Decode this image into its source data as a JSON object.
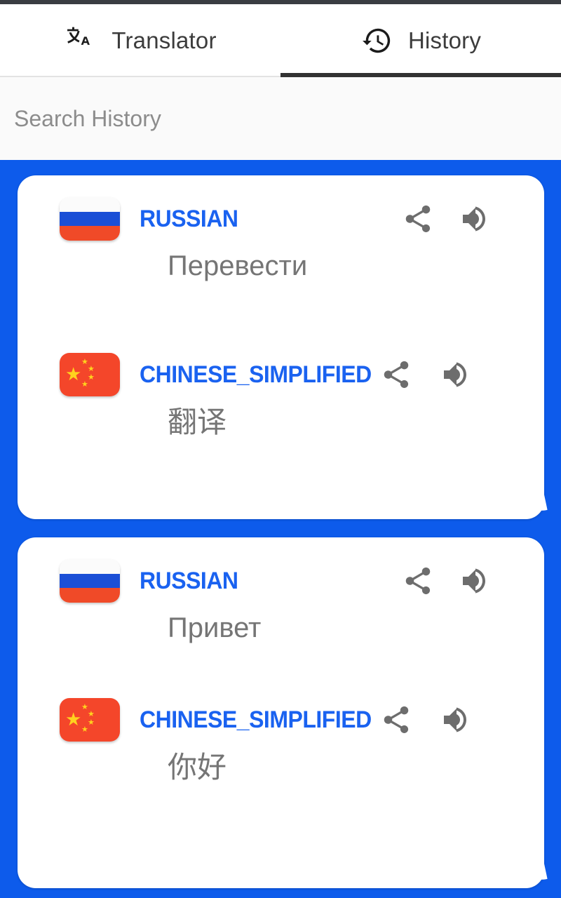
{
  "app": {
    "accent_blue": "#0d5beb",
    "language_label_color": "#1a62f0",
    "body_text_color": "#757575"
  },
  "tabs": [
    {
      "label": "Translator",
      "icon": "translate-icon",
      "active": false
    },
    {
      "label": "History",
      "icon": "history-clock-icon",
      "active": true
    }
  ],
  "search": {
    "placeholder": "Search History",
    "value": ""
  },
  "history": [
    {
      "source": {
        "language": "RUSSIAN",
        "flag": "russia-flag-icon",
        "text": "Перевести",
        "share_icon": "share-icon",
        "speak_icon": "volume-up-icon"
      },
      "target": {
        "language": "CHINESE_SIMPLIFIED",
        "flag": "china-flag-icon",
        "text": "翻译",
        "share_icon": "share-icon",
        "speak_icon": "volume-up-icon"
      }
    },
    {
      "source": {
        "language": "RUSSIAN",
        "flag": "russia-flag-icon",
        "text": "Привет",
        "share_icon": "share-icon",
        "speak_icon": "volume-up-icon"
      },
      "target": {
        "language": "CHINESE_SIMPLIFIED",
        "flag": "china-flag-icon",
        "text": "你好",
        "share_icon": "share-icon",
        "speak_icon": "volume-up-icon"
      }
    }
  ]
}
